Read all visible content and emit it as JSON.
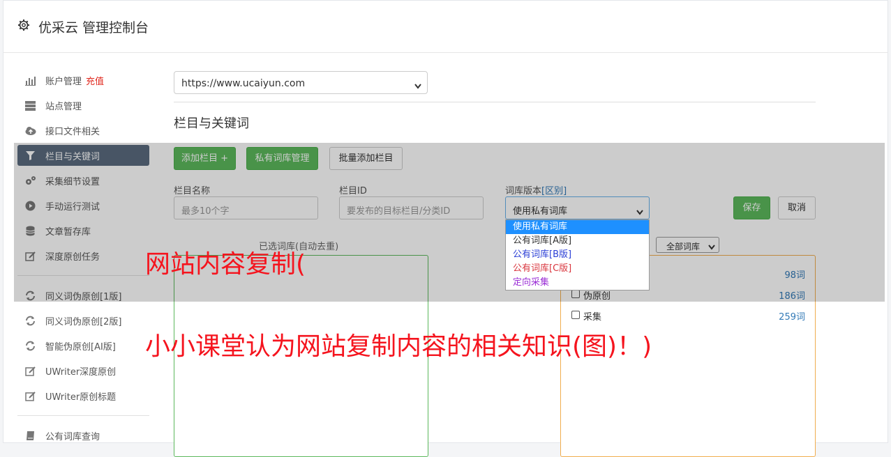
{
  "header": {
    "title": "优采云 管理控制台",
    "icon": "gear-icon"
  },
  "sidebar": {
    "items": [
      {
        "label": "账户管理",
        "badge": "充值",
        "icon": "bar-chart-icon"
      },
      {
        "label": "站点管理",
        "icon": "server-icon"
      },
      {
        "label": "接口文件相关",
        "icon": "cloud-upload-icon"
      },
      {
        "label": "栏目与关键词",
        "icon": "filter-icon",
        "active": true
      },
      {
        "label": "采集细节设置",
        "icon": "cogs-icon"
      },
      {
        "label": "手动运行测试",
        "icon": "play-circle-icon"
      },
      {
        "label": "文章暂存库",
        "icon": "database-icon"
      },
      {
        "label": "深度原创任务",
        "icon": "edit-icon"
      },
      {
        "label": "同义词伪原创[1版]",
        "icon": "refresh-icon"
      },
      {
        "label": "同义词伪原创[2版]",
        "icon": "refresh-icon"
      },
      {
        "label": "智能伪原创[AI版]",
        "icon": "refresh-icon"
      },
      {
        "label": "UWriter深度原创",
        "icon": "edit-icon"
      },
      {
        "label": "UWriter原创标题",
        "icon": "edit-icon"
      },
      {
        "label": "公有词库查询",
        "icon": "book-icon"
      }
    ]
  },
  "main": {
    "site_select": {
      "value": "https://www.ucaiyun.com"
    },
    "section_title": "栏目与关键词",
    "buttons": {
      "add_column": "添加栏目 +",
      "private_lib": "私有词库管理",
      "batch_add": "批量添加栏目"
    },
    "form": {
      "name_label": "栏目名称",
      "name_placeholder": "最多10个字",
      "id_label": "栏目ID",
      "id_placeholder": "要发布的目标栏目/分类ID",
      "version_label": "词库版本",
      "version_link": "[区别]",
      "version_value": "使用私有词库",
      "save": "保存",
      "cancel": "取消"
    },
    "version_options": [
      {
        "label": "使用私有词库",
        "color": "#ffffff",
        "selected": true
      },
      {
        "label": "公有词库[A版]",
        "color": "#333333"
      },
      {
        "label": "公有词库[B版]",
        "color": "#2b3fd6"
      },
      {
        "label": "公有词库[C版]",
        "color": "#d9363e"
      },
      {
        "label": "定向采集",
        "color": "#9b2fd6"
      }
    ],
    "selected_lib_title": "已选词库(自动去重)",
    "all_lib_select": "全部词库",
    "libraries": [
      {
        "name": "",
        "count": "98词"
      },
      {
        "name": "伪原创",
        "count": "186词"
      },
      {
        "name": "采集",
        "count": "259词"
      }
    ]
  },
  "watermark": {
    "line1": "网站内容复制(",
    "line2": "小小课堂认为网站复制内容的相关知识(图)！)"
  }
}
